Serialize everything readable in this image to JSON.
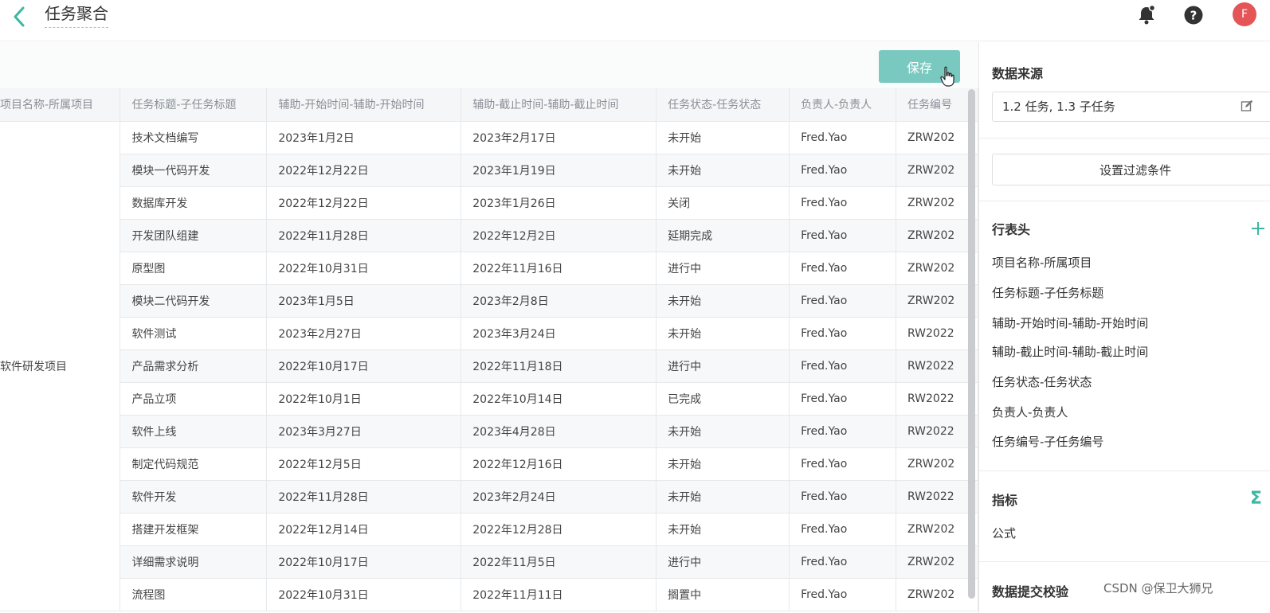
{
  "header": {
    "title": "任务聚合",
    "avatar_letter": "F"
  },
  "toolbar": {
    "save_label": "保存"
  },
  "table": {
    "columns": [
      "项目名称-所属项目",
      "任务标题-子任务标题",
      "辅助-开始时间-辅助-开始时间",
      "辅助-截止时间-辅助-截止时间",
      "任务状态-任务状态",
      "负责人-负责人",
      "任务编号"
    ],
    "group_label": "软件研发项目",
    "rows": [
      [
        "技术文档编写",
        "2023年1月2日",
        "2023年2月17日",
        "未开始",
        "Fred.Yao",
        "ZRW202"
      ],
      [
        "模块一代码开发",
        "2022年12月22日",
        "2023年1月19日",
        "未开始",
        "Fred.Yao",
        "ZRW202"
      ],
      [
        "数据库开发",
        "2022年12月22日",
        "2023年1月26日",
        "关闭",
        "Fred.Yao",
        "ZRW202"
      ],
      [
        "开发团队组建",
        "2022年11月28日",
        "2022年12月2日",
        "延期完成",
        "Fred.Yao",
        "ZRW202"
      ],
      [
        "原型图",
        "2022年10月31日",
        "2022年11月16日",
        "进行中",
        "Fred.Yao",
        "ZRW202"
      ],
      [
        "模块二代码开发",
        "2023年1月5日",
        "2023年2月8日",
        "未开始",
        "Fred.Yao",
        "ZRW202"
      ],
      [
        "软件测试",
        "2023年2月27日",
        "2023年3月24日",
        "未开始",
        "Fred.Yao",
        "RW2022"
      ],
      [
        "产品需求分析",
        "2022年10月17日",
        "2022年11月18日",
        "进行中",
        "Fred.Yao",
        "RW2022"
      ],
      [
        "产品立项",
        "2022年10月1日",
        "2022年10月14日",
        "已完成",
        "Fred.Yao",
        "RW2022"
      ],
      [
        "软件上线",
        "2023年3月27日",
        "2023年4月28日",
        "未开始",
        "Fred.Yao",
        "RW2022"
      ],
      [
        "制定代码规范",
        "2022年12月5日",
        "2022年12月16日",
        "未开始",
        "Fred.Yao",
        "ZRW202"
      ],
      [
        "软件开发",
        "2022年11月28日",
        "2023年2月24日",
        "未开始",
        "Fred.Yao",
        "RW2022"
      ],
      [
        "搭建开发框架",
        "2022年12月14日",
        "2022年12月28日",
        "未开始",
        "Fred.Yao",
        "ZRW202"
      ],
      [
        "详细需求说明",
        "2022年10月17日",
        "2022年11月5日",
        "进行中",
        "Fred.Yao",
        "ZRW202"
      ],
      [
        "流程图",
        "2022年10月31日",
        "2022年11月11日",
        "搁置中",
        "Fred.Yao",
        "ZRW202"
      ]
    ]
  },
  "panel": {
    "data_source_title": "数据来源",
    "data_source_value": "1.2 任务, 1.3 子任务",
    "filter_button": "设置过滤条件",
    "row_header_title": "行表头",
    "row_header_fields": [
      "项目名称-所属项目",
      "任务标题-子任务标题",
      "辅助-开始时间-辅助-开始时间",
      "辅助-截止时间-辅助-截止时间",
      "任务状态-任务状态",
      "负责人-负责人",
      "任务编号-子任务编号"
    ],
    "metrics_title": "指标",
    "metrics_sigma": "Σ",
    "metrics_formula": "公式",
    "validation_title": "数据提交校验"
  },
  "watermark": "CSDN @保卫大狮兄",
  "colors": {
    "accent": "#3bb7a3",
    "save_button": "#79c9c0",
    "avatar": "#e35557"
  }
}
